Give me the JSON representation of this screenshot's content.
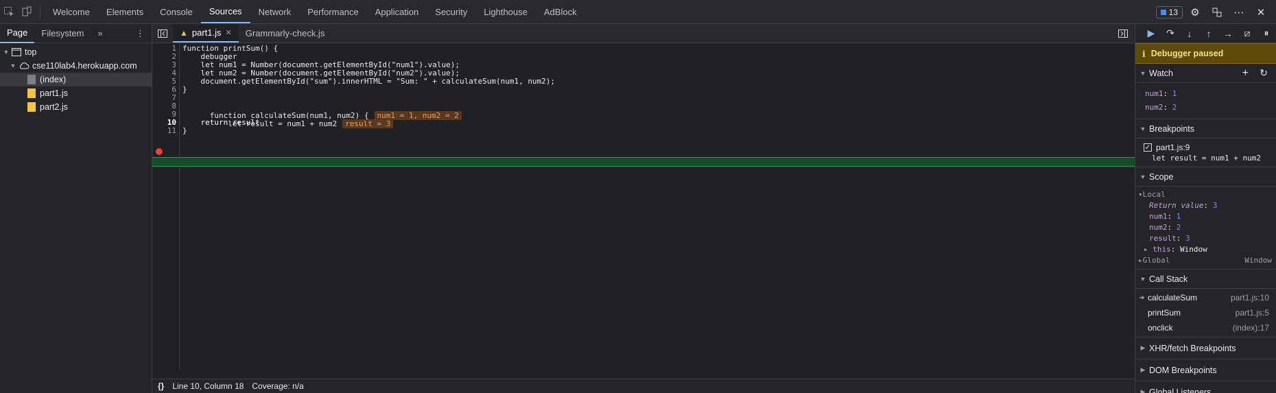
{
  "toolbar": {
    "tabs": [
      "Welcome",
      "Elements",
      "Console",
      "Sources",
      "Network",
      "Performance",
      "Application",
      "Security",
      "Lighthouse",
      "AdBlock"
    ],
    "active_tab": "Sources",
    "issues_count": "13"
  },
  "navigator": {
    "tabs": [
      "Page",
      "Filesystem"
    ],
    "more": "»",
    "menu": "⋮",
    "tree": {
      "top": "top",
      "domain": "cse110lab4.herokuapp.com",
      "files": [
        "(index)",
        "part1.js",
        "part2.js"
      ]
    }
  },
  "editor": {
    "tabs": [
      {
        "label": "part1.js"
      },
      {
        "label": "Grammarly-check.js"
      }
    ],
    "line_numbers": [
      "1",
      "2",
      "3",
      "4",
      "5",
      "6",
      "7",
      "8",
      "9",
      "10",
      "11"
    ],
    "lines": [
      "function printSum() {",
      "    debugger",
      "    let num1 = Number(document.getElementById(\"num1\").value);",
      "    let num2 = Number(document.getElementById(\"num2\").value);",
      "    document.getElementById(\"sum\").innerHTML = \"Sum: \" + calculateSum(num1, num2);",
      "}",
      "",
      "function calculateSum(num1, num2) {",
      "    let result = num1 + num2",
      "    return result",
      "}"
    ],
    "inline_values": {
      "line8": "num1 = 1, num2 = 2",
      "line9": "result = 3"
    },
    "status": {
      "format": "{}",
      "position": "Line 10, Column 18",
      "coverage": "Coverage: n/a"
    }
  },
  "debugger": {
    "paused_label": "Debugger paused",
    "watch": {
      "title": "Watch",
      "items": [
        {
          "name": "num1",
          "value": "1"
        },
        {
          "name": "num2",
          "value": "2"
        }
      ]
    },
    "breakpoints": {
      "title": "Breakpoints",
      "items": [
        {
          "location": "part1.js:9",
          "code": "let result = num1 + num2"
        }
      ]
    },
    "scope": {
      "title": "Scope",
      "local_label": "Local",
      "return_value_label": "Return value",
      "return_value": "3",
      "locals": [
        {
          "name": "num1",
          "value": "1"
        },
        {
          "name": "num2",
          "value": "2"
        },
        {
          "name": "result",
          "value": "3"
        }
      ],
      "this_label": "this",
      "this_value": "Window",
      "global_label": "Global",
      "global_value": "Window"
    },
    "call_stack": {
      "title": "Call Stack",
      "frames": [
        {
          "name": "calculateSum",
          "location": "part1.js:10"
        },
        {
          "name": "printSum",
          "location": "part1.js:5"
        },
        {
          "name": "onclick",
          "location": "(index):17"
        }
      ]
    },
    "sections": [
      "XHR/fetch Breakpoints",
      "DOM Breakpoints",
      "Global Listeners"
    ]
  },
  "colors": {
    "accent": "#8ab4f8",
    "paused_bg": "#5e4b09",
    "exec_line": "#164b2c",
    "breakpoint": "#e8403c"
  }
}
